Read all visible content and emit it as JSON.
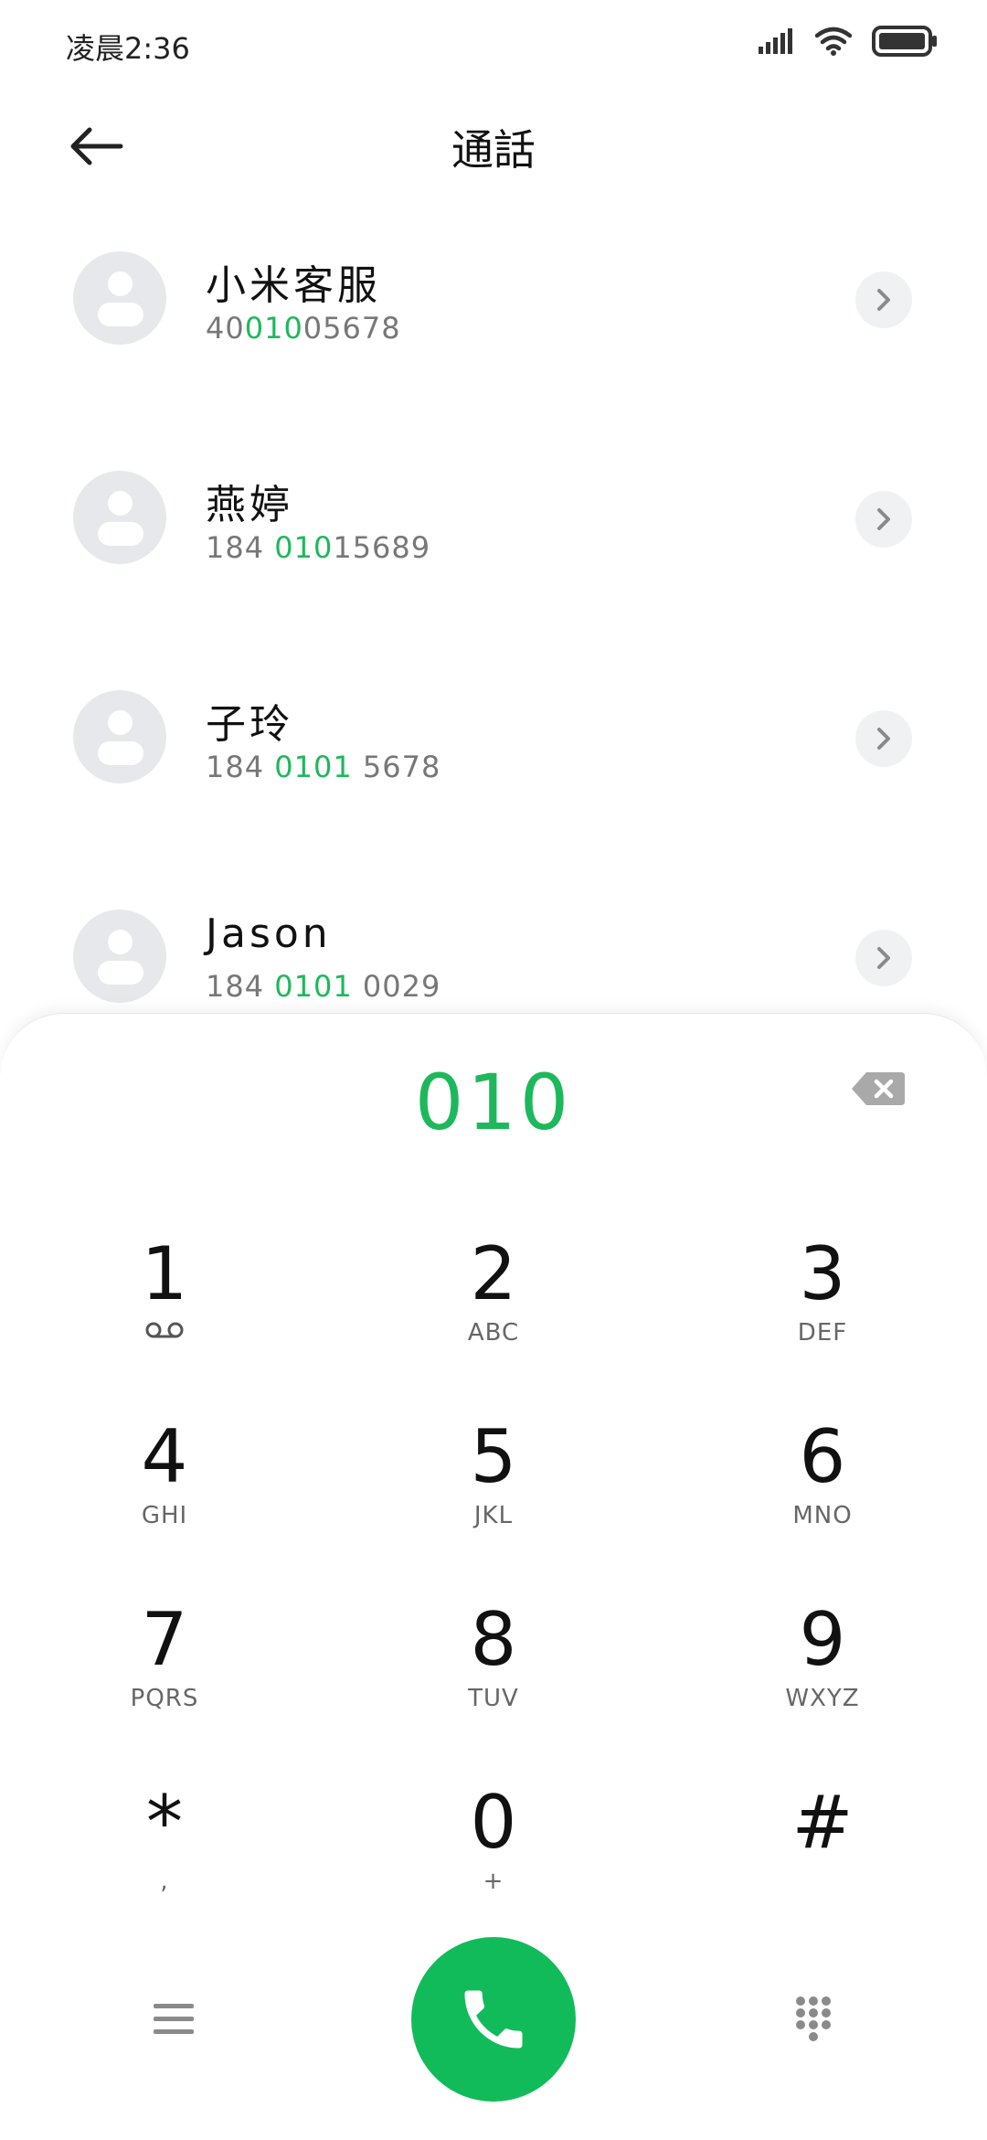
{
  "status_bar": {
    "time": "凌晨2:36"
  },
  "header": {
    "title": "通話"
  },
  "contacts": [
    {
      "name": "小米客服",
      "number_pre": "40",
      "number_match": "010",
      "number_post": "05678"
    },
    {
      "name": "燕婷",
      "number_pre": "184 ",
      "number_match": "010",
      "number_post": "15689"
    },
    {
      "name": "子玲",
      "number_pre": "184 ",
      "number_match": "0101",
      "number_post": " 5678"
    },
    {
      "name": "Jason",
      "number_pre": "184 ",
      "number_match": "0101",
      "number_post": " 0029"
    }
  ],
  "dialpad": {
    "display": "010",
    "keys": [
      {
        "digit": "1",
        "letters": "",
        "sub": "voicemail-icon"
      },
      {
        "digit": "2",
        "letters": "ABC"
      },
      {
        "digit": "3",
        "letters": "DEF"
      },
      {
        "digit": "4",
        "letters": "GHI"
      },
      {
        "digit": "5",
        "letters": "JKL"
      },
      {
        "digit": "6",
        "letters": "MNO"
      },
      {
        "digit": "7",
        "letters": "PQRS"
      },
      {
        "digit": "8",
        "letters": "TUV"
      },
      {
        "digit": "9",
        "letters": "WXYZ"
      },
      {
        "digit": "*",
        "letters": ","
      },
      {
        "digit": "0",
        "letters": "+"
      },
      {
        "digit": "#",
        "letters": ""
      }
    ]
  },
  "colors": {
    "accent": "#1eb85c",
    "call_button": "#12bb5a",
    "avatar_bg": "#e6e8eb"
  }
}
